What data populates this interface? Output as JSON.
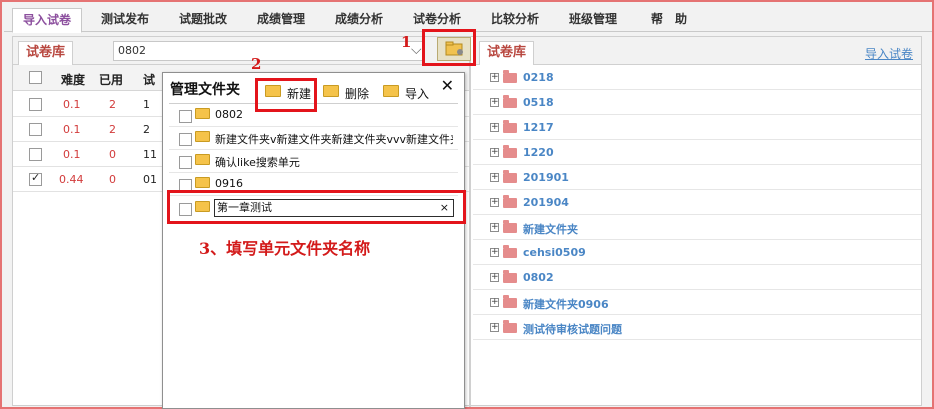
{
  "nav": {
    "tabs": [
      {
        "label": "导入试卷"
      },
      {
        "label": "测试发布"
      },
      {
        "label": "试题批改"
      },
      {
        "label": "成绩管理"
      },
      {
        "label": "成绩分析"
      },
      {
        "label": "试卷分析"
      },
      {
        "label": "比较分析"
      },
      {
        "label": "班级管理"
      },
      {
        "label": "帮　助"
      }
    ],
    "active_index": 0
  },
  "left_panel": {
    "tab_label": "试卷库",
    "path_value": "0802",
    "columns": [
      "难度",
      "已用",
      "试"
    ],
    "rows": [
      {
        "checked": false,
        "difficulty": "0.1",
        "used": "2",
        "col3": "1"
      },
      {
        "checked": false,
        "difficulty": "0.1",
        "used": "2",
        "col3": "2"
      },
      {
        "checked": false,
        "difficulty": "0.1",
        "used": "0",
        "col3": "11"
      },
      {
        "checked": true,
        "difficulty": "0.44",
        "used": "0",
        "col3": "01"
      }
    ]
  },
  "right_panel": {
    "tab_label": "试卷库",
    "import_link": "导入试卷",
    "folders": [
      {
        "label": "0218"
      },
      {
        "label": "0518"
      },
      {
        "label": "1217"
      },
      {
        "label": "1220"
      },
      {
        "label": "201901"
      },
      {
        "label": "201904"
      },
      {
        "label": "新建文件夹"
      },
      {
        "label": "cehsi0509"
      },
      {
        "label": "0802"
      },
      {
        "label": "新建文件夹0906"
      },
      {
        "label": "测试待审核试题问题"
      }
    ]
  },
  "dialog": {
    "title": "管理文件夹",
    "close": "✕",
    "buttons": {
      "new": "新建",
      "delete": "删除",
      "import": "导入"
    },
    "folders": [
      {
        "label": "0802"
      },
      {
        "label": "新建文件夹v新建文件夹新建文件夹vvv新建文件夹"
      },
      {
        "label": "确认like搜索单元"
      },
      {
        "label": "0916"
      }
    ],
    "input_value": "第一章测试",
    "input_clear": "×"
  },
  "annotations": {
    "step1": "1",
    "step2": "2",
    "step3": "3、填写单元文件夹名称"
  },
  "colors": {
    "highlight": "#e3141b",
    "tab_text": "#b8473f",
    "link": "#4a86c5",
    "value_red": "#d23b3b"
  }
}
